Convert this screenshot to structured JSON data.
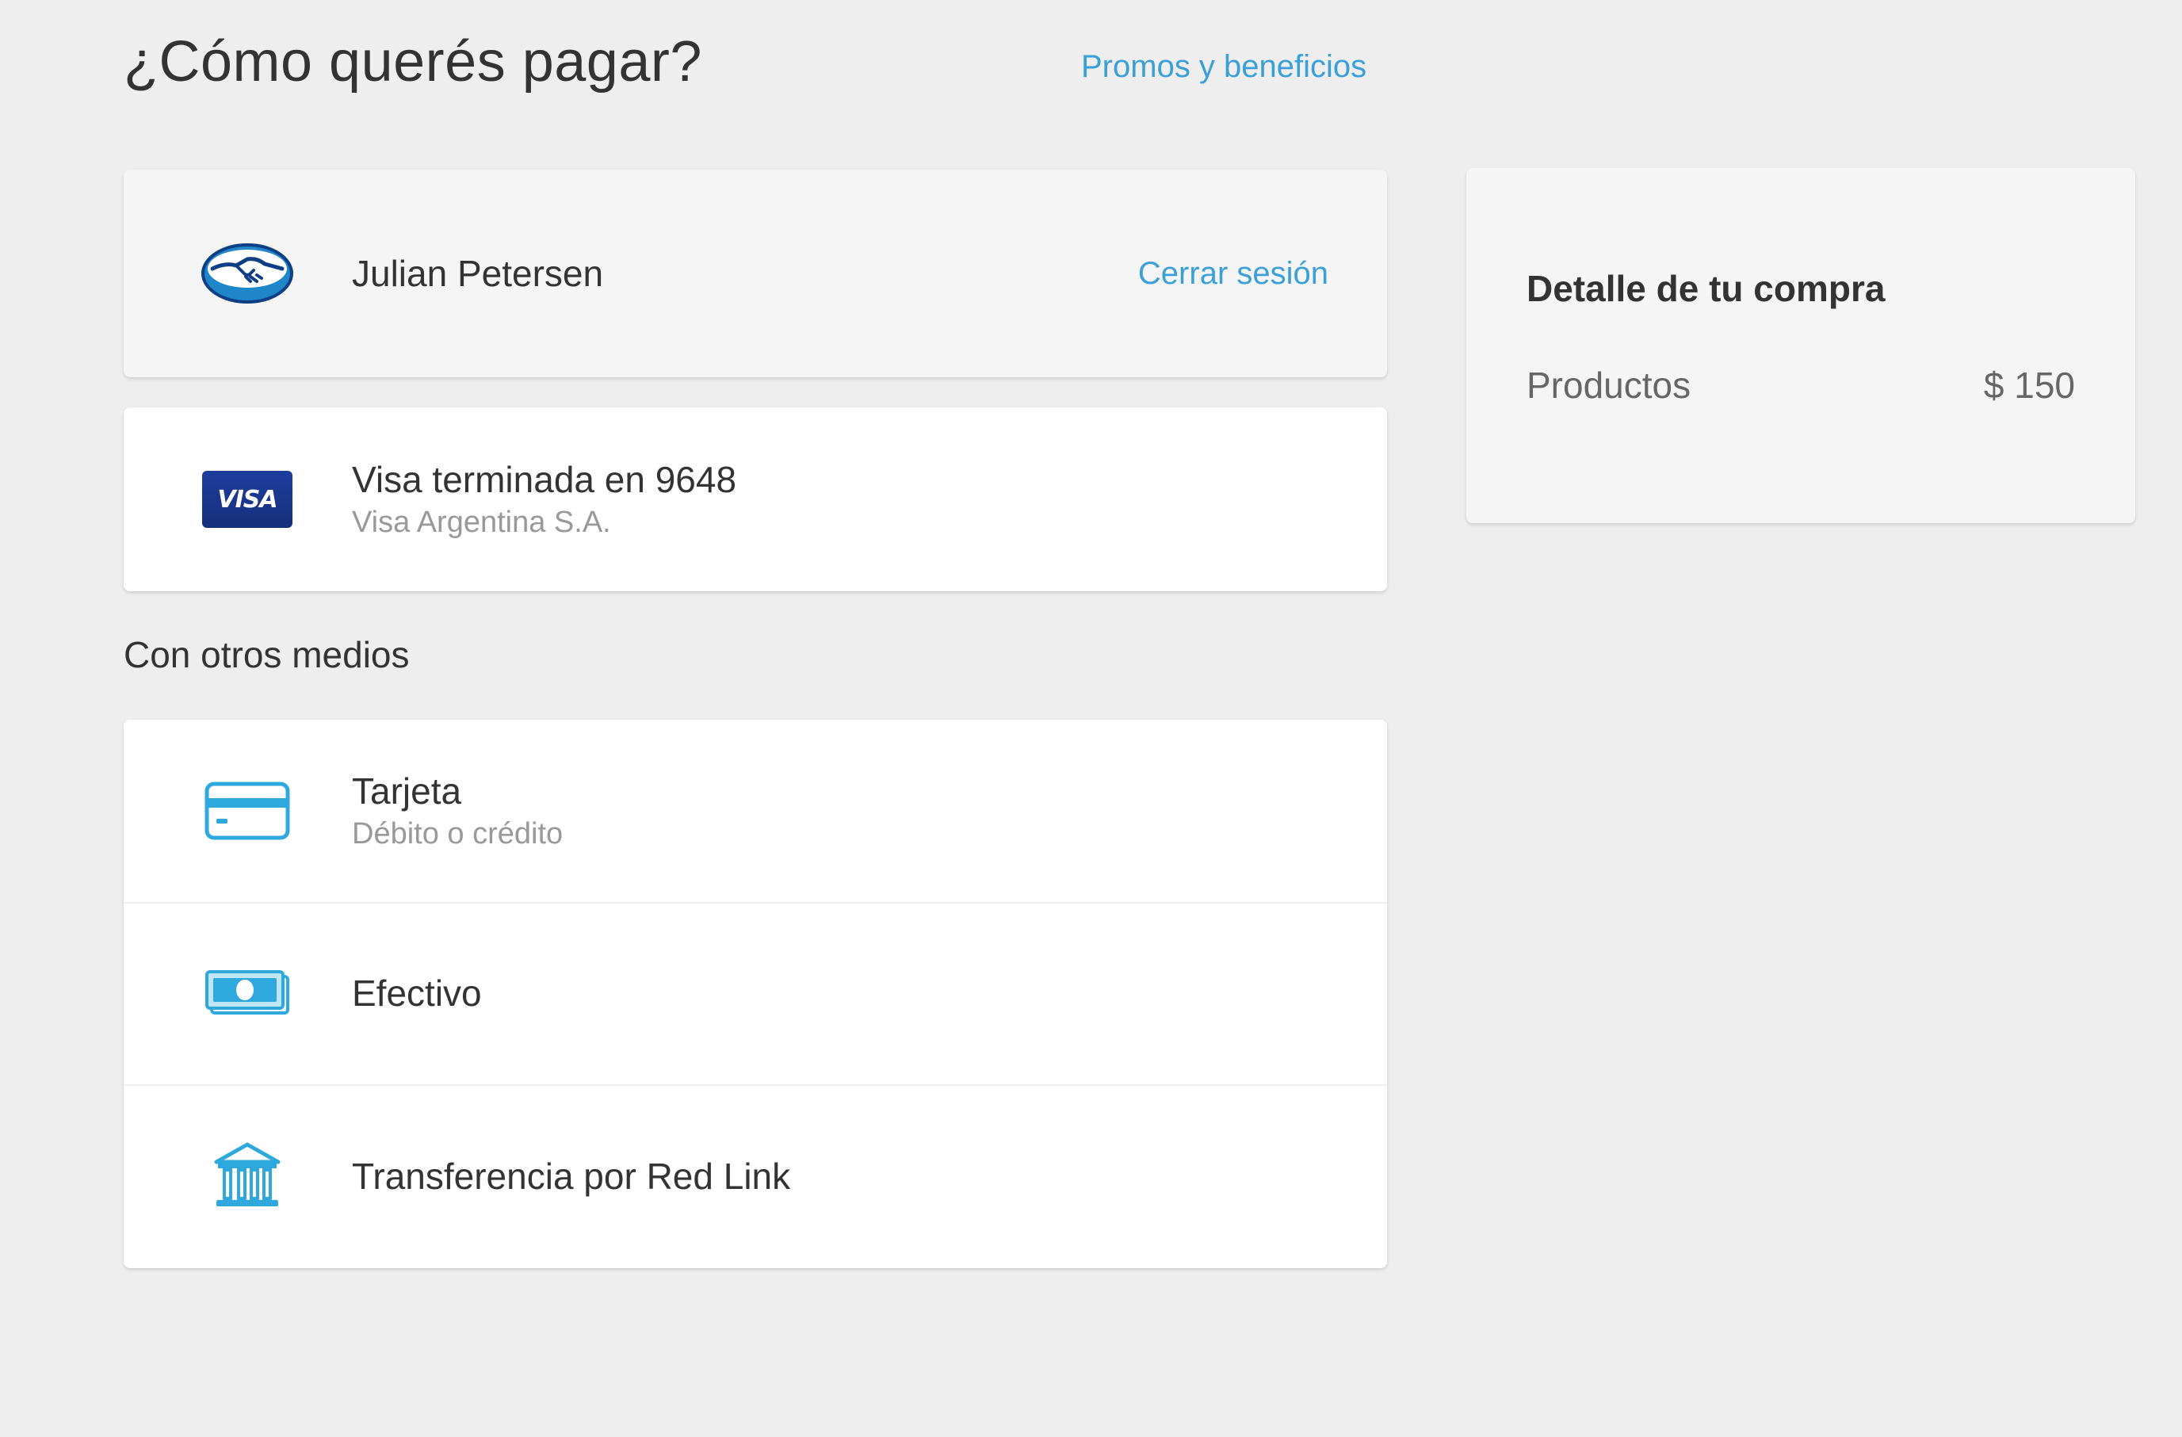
{
  "header": {
    "title": "¿Cómo querés pagar?",
    "promos_link": "Promos y beneficios"
  },
  "account": {
    "user_name": "Julian Petersen",
    "logout_label": "Cerrar sesión",
    "icon": "mercadopago-handshake-icon"
  },
  "saved_card": {
    "title": "Visa terminada en 9648",
    "issuer": "Visa Argentina S.A.",
    "brand_label": "VISA",
    "icon": "visa-icon"
  },
  "other_methods": {
    "section_label": "Con otros medios",
    "items": [
      {
        "title": "Tarjeta",
        "subtitle": "Débito o crédito",
        "icon": "credit-card-icon"
      },
      {
        "title": "Efectivo",
        "subtitle": "",
        "icon": "cash-icon"
      },
      {
        "title": "Transferencia por Red Link",
        "subtitle": "",
        "icon": "bank-icon"
      }
    ]
  },
  "summary": {
    "title": "Detalle de tu compra",
    "products_label": "Productos",
    "products_value": "$ 150"
  },
  "colors": {
    "link": "#3b9fd8",
    "icon_blue": "#2fa8dd",
    "page_background": "#eeeeee",
    "visa_blue": "#1e3d9e"
  }
}
